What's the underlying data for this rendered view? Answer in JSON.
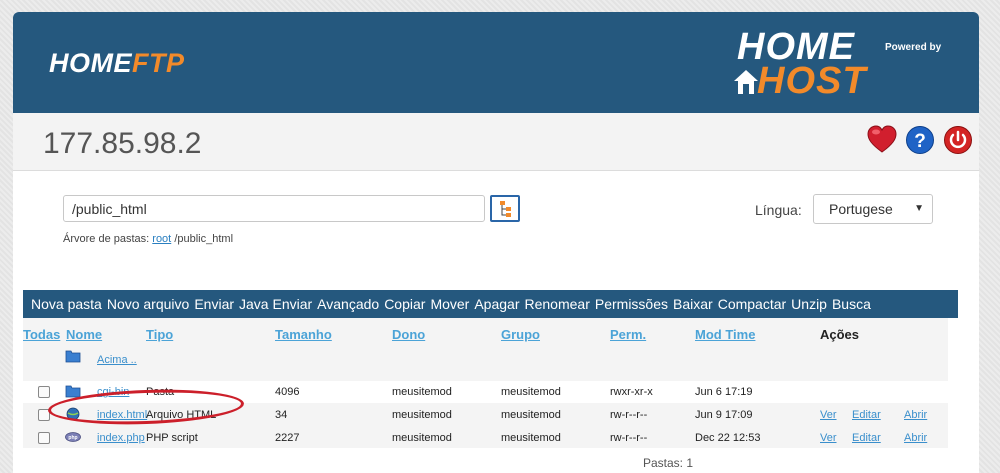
{
  "header": {
    "logo_part1": "HOME",
    "logo_part2": "FTP",
    "brand_home": "HOME",
    "brand_host": "HOST",
    "brand_powered": "Powered by"
  },
  "server": {
    "ip": "177.85.98.2"
  },
  "icons": [
    "heart-icon",
    "help-icon",
    "power-icon"
  ],
  "path": {
    "value": "/public_html",
    "tree_label": "Árvore de pastas:",
    "tree_root": "root",
    "tree_rest": "/public_html"
  },
  "language": {
    "label": "Língua:",
    "selected": "Portugese"
  },
  "toolbar": {
    "items": [
      "Nova pasta",
      "Novo arquivo",
      "Enviar",
      "Java Enviar",
      "Avançado",
      "Copiar",
      "Mover",
      "Apagar",
      "Renomear",
      "Permissões",
      "Baixar",
      "Compactar",
      "Unzip",
      "Busca"
    ]
  },
  "columns": {
    "all": "Todas",
    "name": "Nome",
    "type": "Tipo",
    "size": "Tamanho",
    "owner": "Dono",
    "group": "Grupo",
    "perm": "Perm.",
    "mtime": "Mod Time",
    "actions": "Ações"
  },
  "up_link": "Acima ..",
  "files": [
    {
      "name": "cgi-bin",
      "type": "Pasta",
      "size": "4096",
      "owner": "meusitemod",
      "group": "meusitemod",
      "perm": "rwxr-xr-x",
      "mtime": "Jun 6 17:19",
      "icon": "folder-icon"
    },
    {
      "name": "index.html",
      "type": "Arquivo HTML",
      "size": "34",
      "owner": "meusitemod",
      "group": "meusitemod",
      "perm": "rw-r--r--",
      "mtime": "Jun 9 17:09",
      "icon": "html-file-icon",
      "view": "Ver",
      "edit": "Editar",
      "open": "Abrir"
    },
    {
      "name": "index.php",
      "type": "PHP script",
      "size": "2227",
      "owner": "meusitemod",
      "group": "meusitemod",
      "perm": "rw-r--r--",
      "mtime": "Dec 22 12:53",
      "icon": "php-file-icon",
      "view": "Ver",
      "edit": "Editar",
      "open": "Abrir"
    }
  ],
  "footer": {
    "folders": "Pastas: 1"
  },
  "colors": {
    "header_bg": "#25587e",
    "accent_orange": "#f28a2a",
    "link": "#3a8fcc",
    "highlight_oval": "#cc1f2a"
  }
}
